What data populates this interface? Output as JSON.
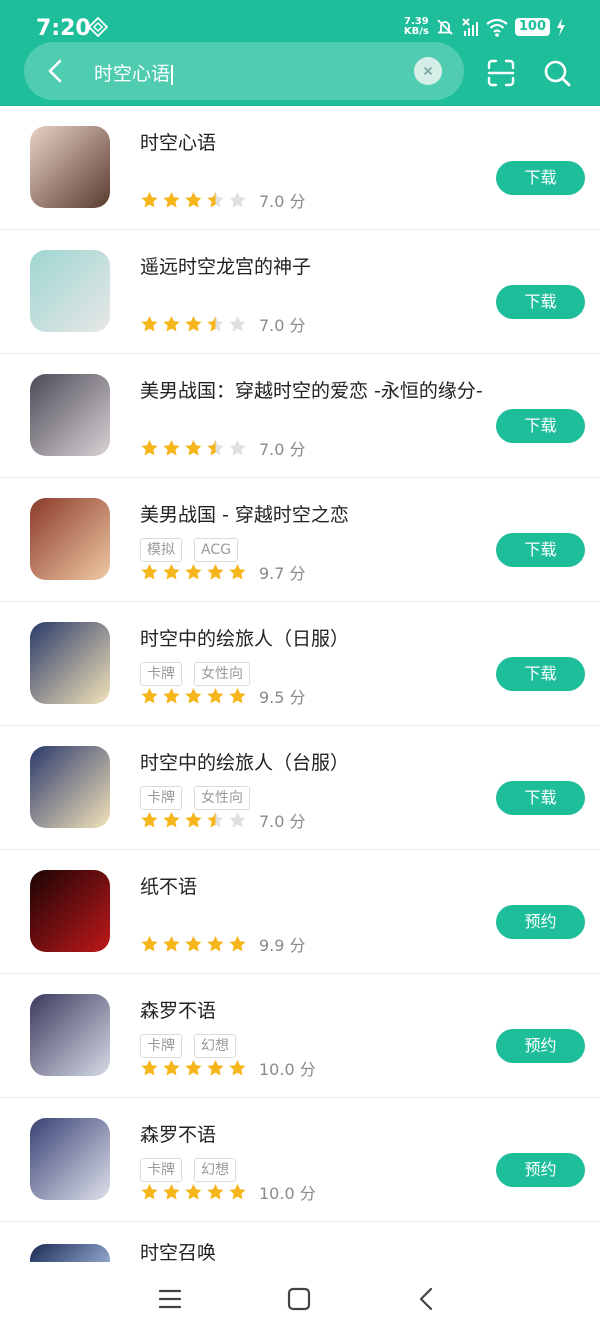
{
  "status_bar": {
    "time": "7:20",
    "net_speed_value": "7.39",
    "net_speed_unit": "KB/s",
    "battery": "100"
  },
  "search": {
    "query": "时空心语"
  },
  "colors": {
    "brand": "#1fbe9b",
    "star_filled": "#f7b51c",
    "star_empty": "#e0e0e0"
  },
  "results": [
    {
      "name": "时空心语",
      "tags": [],
      "rating": 3.5,
      "score": "7.0 分",
      "button": "下载",
      "icon_bg": [
        "#e8d3c6",
        "#5a3a2e"
      ]
    },
    {
      "name": "遥远时空龙宫的神子",
      "tags": [],
      "rating": 3.5,
      "score": "7.0 分",
      "button": "下载",
      "icon_bg": [
        "#9ed6d1",
        "#e7e7e7"
      ]
    },
    {
      "name": "美男战国：穿越时空的爱恋 -永恒的缘分-",
      "tags": [],
      "rating": 3.5,
      "score": "7.0 分",
      "button": "下载",
      "icon_bg": [
        "#4d4a57",
        "#d9d3d6"
      ]
    },
    {
      "name": "美男战国 - 穿越时空之恋",
      "tags": [
        "模拟",
        "ACG"
      ],
      "rating": 5,
      "score": "9.7 分",
      "button": "下载",
      "icon_bg": [
        "#8a3a2a",
        "#f0c9a4"
      ]
    },
    {
      "name": "时空中的绘旅人（日服）",
      "tags": [
        "卡牌",
        "女性向"
      ],
      "rating": 5,
      "score": "9.5 分",
      "button": "下载",
      "icon_bg": [
        "#2b3a6b",
        "#f3e3b9"
      ]
    },
    {
      "name": "时空中的绘旅人（台服）",
      "tags": [
        "卡牌",
        "女性向"
      ],
      "rating": 3.5,
      "score": "7.0 分",
      "button": "下载",
      "icon_bg": [
        "#2b3a6b",
        "#f3e3b9"
      ]
    },
    {
      "name": "纸不语",
      "tags": [],
      "rating": 5,
      "score": "9.9 分",
      "button": "预约",
      "icon_bg": [
        "#1a0505",
        "#c0181a"
      ]
    },
    {
      "name": "森罗不语",
      "tags": [
        "卡牌",
        "幻想"
      ],
      "rating": 5,
      "score": "10.0 分",
      "button": "预约",
      "icon_bg": [
        "#3d3a5e",
        "#d6dbe6"
      ]
    },
    {
      "name": "森罗不语",
      "tags": [
        "卡牌",
        "幻想"
      ],
      "rating": 5,
      "score": "10.0 分",
      "button": "预约",
      "icon_bg": [
        "#3a4275",
        "#dde0ea"
      ]
    }
  ],
  "partial_item": {
    "name": "时空召唤",
    "icon_bg": [
      "#1b2b55",
      "#9fb4d9"
    ]
  }
}
